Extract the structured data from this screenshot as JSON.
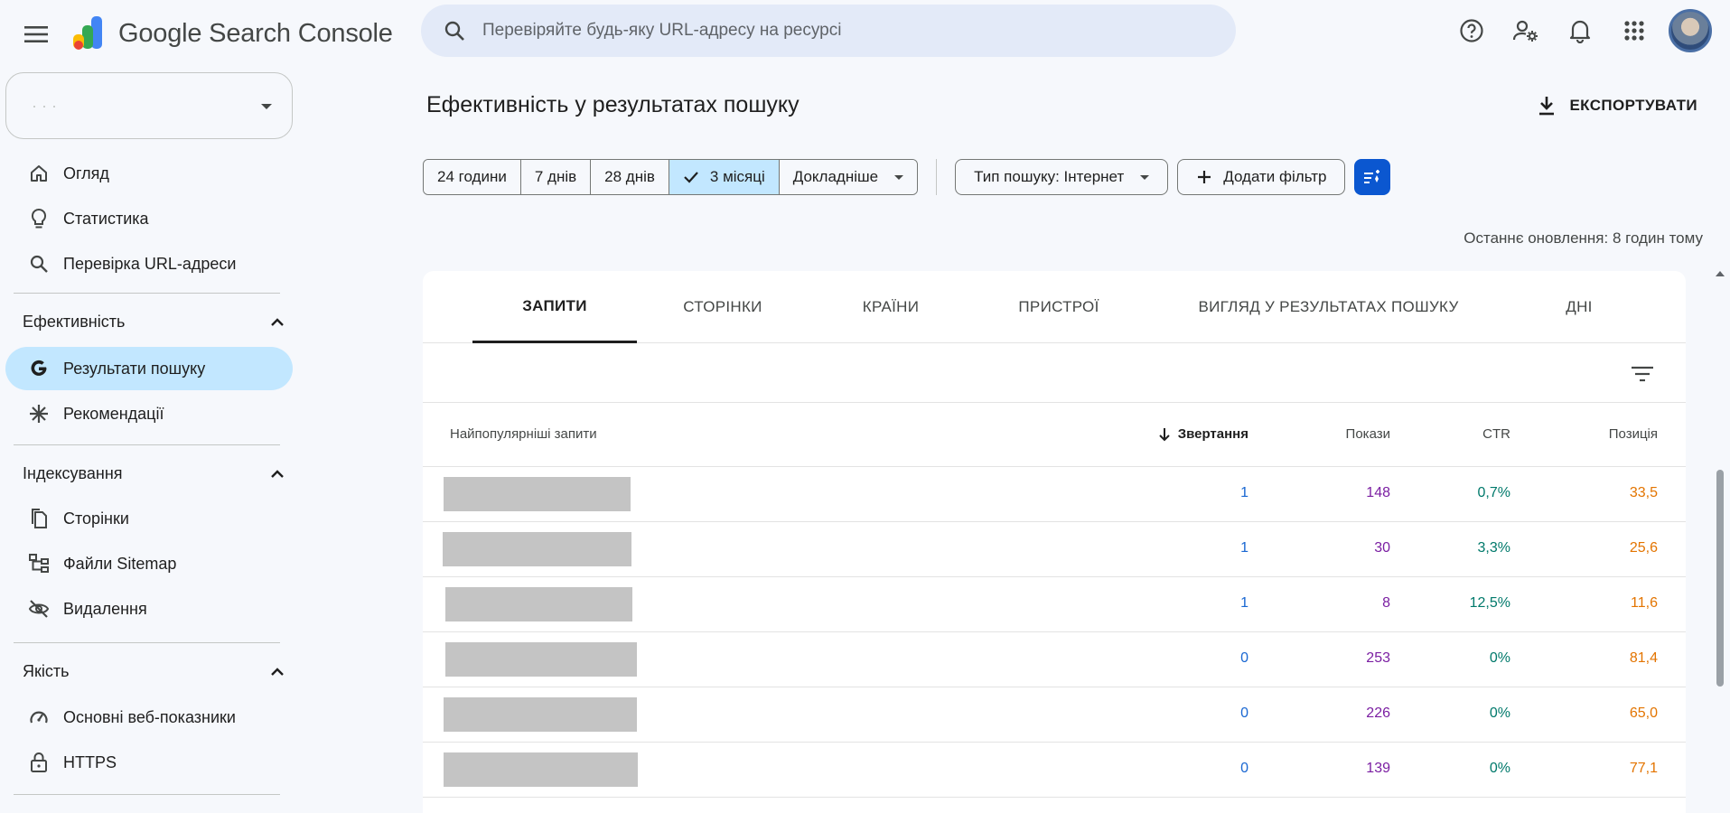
{
  "app": {
    "title": "Google Search Console"
  },
  "search": {
    "placeholder": "Перевіряйте будь-яку URL-адресу на ресурсі"
  },
  "sidebar": {
    "property_name": "· · ·",
    "items": [
      {
        "label": "Огляд",
        "icon": "home-icon"
      },
      {
        "label": "Статистика",
        "icon": "lightbulb-icon"
      },
      {
        "label": "Перевірка URL-адреси",
        "icon": "search-icon"
      }
    ],
    "sections": [
      {
        "label": "Ефективність",
        "items": [
          {
            "label": "Результати пошуку",
            "icon": "google-g-icon",
            "active": true
          },
          {
            "label": "Рекомендації",
            "icon": "asterisk-icon"
          }
        ]
      },
      {
        "label": "Індексування",
        "items": [
          {
            "label": "Сторінки",
            "icon": "pages-icon"
          },
          {
            "label": "Файли Sitemap",
            "icon": "sitemap-icon"
          },
          {
            "label": "Видалення",
            "icon": "eye-off-icon"
          }
        ]
      },
      {
        "label": "Якість",
        "items": [
          {
            "label": "Основні веб-показники",
            "icon": "gauge-icon"
          },
          {
            "label": "HTTPS",
            "icon": "lock-icon"
          }
        ]
      }
    ]
  },
  "main": {
    "title": "Ефективність у результатах пошуку",
    "export_label": "ЕКСПОРТУВАТИ",
    "date_ranges": [
      "24 години",
      "7 днів",
      "28 днів",
      "3 місяці",
      "Докладніше"
    ],
    "selected_range": "3 місяці",
    "search_type": "Тип пошуку: Інтернет",
    "add_filter": "Додати фільтр",
    "last_updated": "Останнє оновлення: 8 годин тому",
    "tabs": [
      "ЗАПИТИ",
      "СТОРІНКИ",
      "КРАЇНИ",
      "ПРИСТРОЇ",
      "ВИГЛЯД У РЕЗУЛЬТАТАХ ПОШУКУ",
      "ДНІ"
    ],
    "active_tab": "ЗАПИТИ",
    "table": {
      "headers": {
        "query": "Найпопулярніші запити",
        "clicks": "Звертання",
        "impressions": "Покази",
        "ctr": "CTR",
        "position": "Позиція"
      },
      "rows": [
        {
          "clicks": "1",
          "impressions": "148",
          "ctr": "0,7%",
          "position": "33,5"
        },
        {
          "clicks": "1",
          "impressions": "30",
          "ctr": "3,3%",
          "position": "25,6"
        },
        {
          "clicks": "1",
          "impressions": "8",
          "ctr": "12,5%",
          "position": "11,6"
        },
        {
          "clicks": "0",
          "impressions": "253",
          "ctr": "0%",
          "position": "81,4"
        },
        {
          "clicks": "0",
          "impressions": "226",
          "ctr": "0%",
          "position": "65,0"
        },
        {
          "clicks": "0",
          "impressions": "139",
          "ctr": "0%",
          "position": "77,1"
        }
      ]
    }
  },
  "colors": {
    "clicks": "#1967d2",
    "impressions": "#7b1fa2",
    "ctr": "#00796b",
    "position": "#e37400",
    "accent": "#0b57d0",
    "active_bg": "#c2e7ff"
  }
}
